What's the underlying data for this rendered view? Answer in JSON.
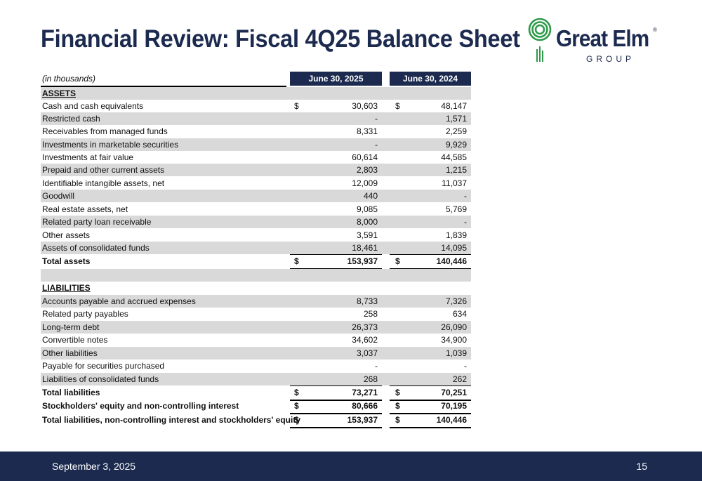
{
  "title": "Financial Review: Fiscal 4Q25 Balance Sheet",
  "logo": {
    "name": "Great Elm",
    "sub": "GROUP",
    "reg": "®"
  },
  "table": {
    "units": "(in thousands)",
    "col1": "June 30, 2025",
    "col2": "June 30, 2024",
    "rows": [
      {
        "label": "ASSETS",
        "style": "section",
        "v1": "",
        "v2": "",
        "cur1": "",
        "cur2": ""
      },
      {
        "label": "Cash and cash equivalents",
        "v1": "30,603",
        "v2": "48,147",
        "cur1": "$",
        "cur2": "$"
      },
      {
        "label": "Restricted cash",
        "v1": "-",
        "v2": "1,571",
        "cur1": "",
        "cur2": ""
      },
      {
        "label": "Receivables from managed funds",
        "v1": "8,331",
        "v2": "2,259",
        "cur1": "",
        "cur2": ""
      },
      {
        "label": "Investments in marketable securities",
        "v1": "-",
        "v2": "9,929",
        "cur1": "",
        "cur2": ""
      },
      {
        "label": "Investments at fair value",
        "v1": "60,614",
        "v2": "44,585",
        "cur1": "",
        "cur2": ""
      },
      {
        "label": "Prepaid and other current assets",
        "v1": "2,803",
        "v2": "1,215",
        "cur1": "",
        "cur2": ""
      },
      {
        "label": "Identifiable intangible assets, net",
        "v1": "12,009",
        "v2": "11,037",
        "cur1": "",
        "cur2": ""
      },
      {
        "label": "Goodwill",
        "v1": "440",
        "v2": "-",
        "cur1": "",
        "cur2": ""
      },
      {
        "label": "Real estate assets, net",
        "v1": "9,085",
        "v2": "5,769",
        "cur1": "",
        "cur2": ""
      },
      {
        "label": "Related party loan receivable",
        "v1": "8,000",
        "v2": "-",
        "cur1": "",
        "cur2": ""
      },
      {
        "label": "Other assets",
        "v1": "3,591",
        "v2": "1,839",
        "cur1": "",
        "cur2": ""
      },
      {
        "label": "Assets of consolidated funds",
        "v1": "18,461",
        "v2": "14,095",
        "cur1": "",
        "cur2": ""
      },
      {
        "label": "Total assets",
        "style": "total",
        "v1": "153,937",
        "v2": "140,446",
        "cur1": "$",
        "cur2": "$"
      },
      {
        "label": "",
        "style": "blank",
        "v1": "",
        "v2": "",
        "cur1": "",
        "cur2": ""
      },
      {
        "label": "LIABILITIES",
        "style": "section",
        "v1": "",
        "v2": "",
        "cur1": "",
        "cur2": ""
      },
      {
        "label": "Accounts payable and accrued expenses",
        "v1": "8,733",
        "v2": "7,326",
        "cur1": "",
        "cur2": ""
      },
      {
        "label": "Related party payables",
        "v1": "258",
        "v2": "634",
        "cur1": "",
        "cur2": ""
      },
      {
        "label": "Long-term debt",
        "v1": "26,373",
        "v2": "26,090",
        "cur1": "",
        "cur2": ""
      },
      {
        "label": "Convertible notes",
        "v1": "34,602",
        "v2": "34,900",
        "cur1": "",
        "cur2": ""
      },
      {
        "label": "Other liabilities",
        "v1": "3,037",
        "v2": "1,039",
        "cur1": "",
        "cur2": ""
      },
      {
        "label": "Payable for securities purchased",
        "v1": "-",
        "v2": "-",
        "cur1": "",
        "cur2": ""
      },
      {
        "label": "Liabilities of consolidated funds",
        "v1": "268",
        "v2": "262",
        "cur1": "",
        "cur2": ""
      },
      {
        "label": "Total liabilities",
        "style": "total",
        "v1": "73,271",
        "v2": "70,251",
        "cur1": "$",
        "cur2": "$"
      },
      {
        "label": "Stockholders' equity and non-controlling interest",
        "style": "total",
        "v1": "80,666",
        "v2": "70,195",
        "cur1": "$",
        "cur2": "$"
      },
      {
        "label": "Total liabilities, non-controlling interest and stockholders' equity",
        "style": "total",
        "v1": "153,937",
        "v2": "140,446",
        "cur1": "$",
        "cur2": "$"
      }
    ]
  },
  "footer": {
    "date": "September 3, 2025",
    "page": "15"
  }
}
